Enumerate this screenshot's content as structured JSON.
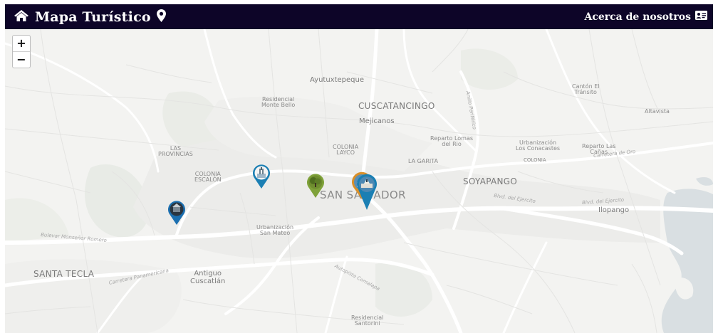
{
  "navbar": {
    "title": "Mapa Turístico",
    "about_label": "Acerca de nosotros",
    "home_icon": "home-icon",
    "pin_icon": "map-pin-icon",
    "card_icon": "id-card-icon",
    "background": "#0d0528"
  },
  "zoom": {
    "in": "+",
    "out": "−"
  },
  "places": {
    "ayutuxtepeque": "Ayutuxtepeque",
    "residencial_monte_bello_1": "Residencial",
    "residencial_monte_bello_2": "Monte Bello",
    "cuscatancingo": "CUSCATANCINGO",
    "mejicanos": "Mejicanos",
    "canton_1": "Cantón El",
    "canton_2": "Tránsito",
    "altavista": "Altavista",
    "las_provincias_1": "LAS",
    "las_provincias_2": "PROVINCIAS",
    "colonia_layco_1": "COLONIA",
    "colonia_layco_2": "LAYCO",
    "reparto_lomas_1": "Reparto Lomas",
    "reparto_lomas_2": "del Rio",
    "urb_conacastes_1": "Urbanización",
    "urb_conacastes_2": "Los Conacastes",
    "colonia_small": "COLONIA",
    "reparto_canas_1": "Reparto Las",
    "reparto_canas_2": "Cañas",
    "la_garita": "LA GARITA",
    "colonia_escalon_1": "COLONIA",
    "colonia_escalon_2": "ESCALÓN",
    "soyapango": "SOYAPANGO",
    "san_salvador": "SAN SALVADOR",
    "ilopango": "Ilopango",
    "urb_san_mateo_1": "Urbanización",
    "urb_san_mateo_2": "San Mateo",
    "santa_tecla": "SANTA TECLA",
    "antiguo_1": "Antiguo",
    "antiguo_2": "Cuscatlán",
    "residencial_santorini_1": "Residencial",
    "residencial_santorini_2": "Santorini"
  },
  "roads": {
    "boulevard_monsenor_romero": "Bulevar Monseñor Romero",
    "carretera_panamericana": "Carretera Panamericana",
    "autopista_comalapa": "Autopista Comalapa",
    "blvd_del_ejercito_1": "Blvd. del Ejercito",
    "blvd_del_ejercito_2": "Blvd. del Ejercito",
    "carretera_de_oro": "Carretera de Oro",
    "anillo_periferico": "Anillo Periférico"
  },
  "markers": [
    {
      "name": "marker-monument",
      "color": "#1b7fb3",
      "icon": "monument-icon"
    },
    {
      "name": "marker-park",
      "color": "#7fa23a",
      "icon": "tree-icon"
    },
    {
      "name": "marker-cathedral-a",
      "color": "#d9902a",
      "icon": "cathedral-icon"
    },
    {
      "name": "marker-cathedral-b",
      "color": "#1b7fb3",
      "icon": "plaza-icon"
    },
    {
      "name": "marker-west",
      "color": "#1b6fb0",
      "icon": "building-icon"
    }
  ],
  "colors": {
    "map_bg": "#f3f3f1",
    "road": "#ffffff",
    "water": "#d5dde0",
    "green": "#e6eae4"
  }
}
